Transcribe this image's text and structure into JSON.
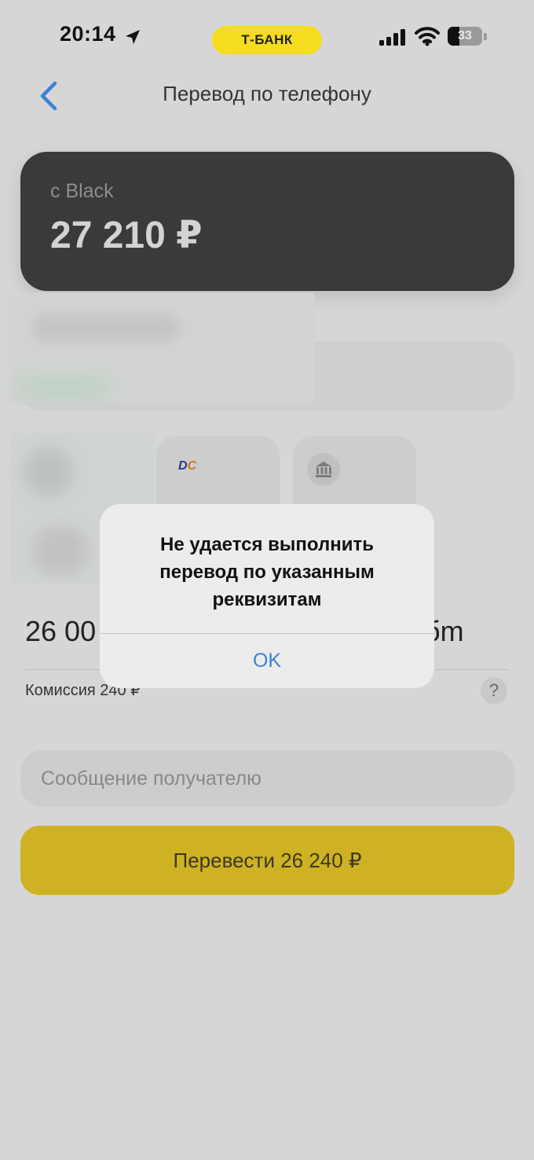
{
  "status_bar": {
    "time": "20:14",
    "bank_badge": "Т-БАНК",
    "battery_level": "33",
    "battery_fraction": 0.33
  },
  "nav": {
    "title": "Перевод по телефону",
    "back_icon": "chevron-left-icon"
  },
  "source_card": {
    "label": "с Black",
    "amount": "27 210 ₽"
  },
  "bank_tiles": [
    {
      "logo_text_a": "D",
      "logo_text_b": "C"
    },
    {
      "icon": "bank-building-icon"
    }
  ],
  "amount_row": {
    "amount_visible_left": "26 00",
    "amount_visible_right": "бm",
    "commission": "Комиссия 240 ₽",
    "help_label": "?"
  },
  "message": {
    "placeholder": "Сообщение получателю"
  },
  "primary_button": {
    "label": "Перевести 26 240 ₽"
  },
  "alert": {
    "title_line1": "Не удается выполнить",
    "title_line2": "перевод по указанным",
    "title_line3": "реквизитам",
    "ok_label": "OK"
  },
  "colors": {
    "background": "#d6d6d6",
    "card": "#3a3a3a",
    "accent_yellow": "#ceb223",
    "badge_yellow": "#f5dc1f",
    "alert_link": "#3d80d6"
  }
}
